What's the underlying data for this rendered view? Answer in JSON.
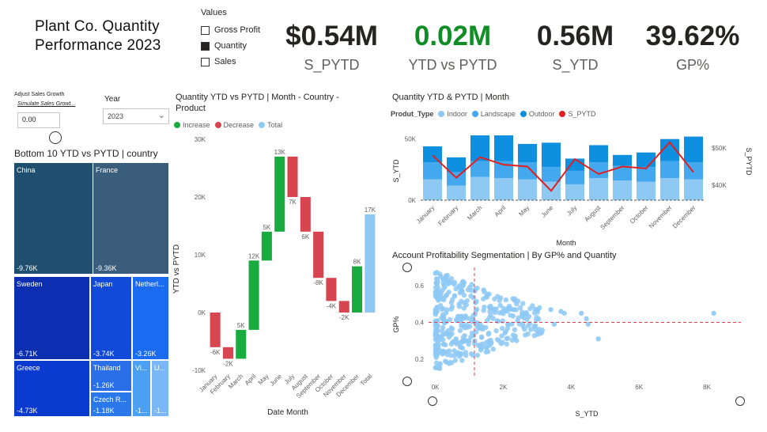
{
  "title": "Plant Co. Quantity Performance 2023",
  "title_line1": "Plant Co. Quantity",
  "title_line2": "Performance 2023",
  "values_legend": {
    "header": "Values",
    "options": [
      {
        "label": "Gross Profit",
        "selected": false
      },
      {
        "label": "Quantity",
        "selected": true
      },
      {
        "label": "Sales",
        "selected": false
      }
    ]
  },
  "kpis": [
    {
      "value": "$0.54M",
      "label": "S_PYTD"
    },
    {
      "value": "0.02M",
      "label": "YTD vs PYTD"
    },
    {
      "value": "0.56M",
      "label": "S_YTD"
    },
    {
      "value": "39.62%",
      "label": "GP%"
    }
  ],
  "growth": {
    "label": "Adjust Sales Growth",
    "sub": "Simulate Sales Growt...",
    "value": "0.00"
  },
  "year_filter": {
    "label": "Year",
    "value": "2023"
  },
  "treemap": {
    "title": "Bottom 10 YTD vs PYTD | country",
    "tiles": [
      {
        "name": "China",
        "value": "-9.76K",
        "color": "#1f4e6e"
      },
      {
        "name": "France",
        "value": "-9.36K",
        "color": "#3b5d7c"
      },
      {
        "name": "Sweden",
        "value": "-6.71K",
        "color": "#0b2fb0"
      },
      {
        "name": "Japan",
        "value": "-3.74K",
        "color": "#1149d8"
      },
      {
        "name": "Netherl...",
        "value": "-3.26K",
        "color": "#1a6bf0"
      },
      {
        "name": "Greece",
        "value": "-4.73K",
        "color": "#0b3ad0"
      },
      {
        "name": "Thailand",
        "value": "-1.26K",
        "color": "#2a6fe8"
      },
      {
        "name": "Czech R...",
        "value": "-1.18K",
        "color": "#2a78ea"
      },
      {
        "name": "Vi...",
        "value": "-1...",
        "color": "#4ba0f2"
      },
      {
        "name": "U...",
        "value": "-1...",
        "color": "#7ab8f5"
      }
    ]
  },
  "waterfall": {
    "title_line1": "Quantity YTD vs PYTD | Month - Country -",
    "title_line2": "Product",
    "legend": [
      {
        "label": "Increase",
        "color": "#1aab40"
      },
      {
        "label": "Decrease",
        "color": "#d64550"
      },
      {
        "label": "Total",
        "color": "#8ec9f4"
      }
    ],
    "ylabel": "YTD vs PYTD",
    "xlabel": "Date Month"
  },
  "combo": {
    "title": "Quantity YTD & PYTD | Month",
    "legend_title": "Produt_Type",
    "legend": [
      {
        "label": "Indoor",
        "color": "#8ec9f4"
      },
      {
        "label": "Landscape",
        "color": "#44a8ee"
      },
      {
        "label": "Outdoor",
        "color": "#0f8fe0"
      },
      {
        "label": "S_PYTD",
        "color": "#e02020"
      }
    ],
    "ylabel": "S_YTD",
    "y2label": "S_PYTD",
    "xlabel": "Month"
  },
  "scatter": {
    "title": "Account Profitability Segmentation | By GP% and Quantity",
    "xlabel": "S_YTD",
    "ylabel": "GP%"
  },
  "chart_data": [
    {
      "type": "bar",
      "subtype": "waterfall",
      "title": "Quantity YTD vs PYTD | Month - Country - Product",
      "xlabel": "Date Month",
      "ylabel": "YTD vs PYTD",
      "ylim": [
        -10000,
        30000
      ],
      "yticks": [
        "-10K",
        "0K",
        "10K",
        "20K",
        "30K"
      ],
      "categories": [
        "January",
        "February",
        "March",
        "April",
        "May",
        "June",
        "July",
        "August",
        "September",
        "October",
        "November",
        "December",
        "Total"
      ],
      "values": [
        -6000,
        -2000,
        5000,
        12000,
        5000,
        13000,
        -7000,
        -6000,
        -8000,
        -4000,
        -2000,
        8000,
        17000
      ],
      "labels": [
        "-6K",
        "-2K",
        "5K",
        "12K",
        "5K",
        "13K",
        "7K",
        "6K",
        "-8K",
        "-4K",
        "-2K",
        "8K",
        "17K"
      ],
      "kinds": [
        "decrease",
        "decrease",
        "increase",
        "increase",
        "increase",
        "increase",
        "decrease",
        "decrease",
        "decrease",
        "decrease",
        "decrease",
        "increase",
        "total"
      ]
    },
    {
      "type": "bar",
      "subtype": "stacked-column-line",
      "title": "Quantity YTD & PYTD | Month",
      "xlabel": "Month",
      "ylabel": "S_YTD",
      "y2label": "S_PYTD",
      "ylim": [
        0,
        55000
      ],
      "yticks": [
        "0K",
        "50K"
      ],
      "y2ticks": [
        "$40K",
        "$50K"
      ],
      "categories": [
        "January",
        "February",
        "March",
        "April",
        "May",
        "June",
        "July",
        "August",
        "September",
        "October",
        "November",
        "December"
      ],
      "series": [
        {
          "name": "Indoor",
          "values": [
            17000,
            12000,
            19000,
            18000,
            17000,
            15000,
            13000,
            18000,
            16000,
            15000,
            18000,
            17000
          ]
        },
        {
          "name": "Landscape",
          "values": [
            14000,
            11000,
            13000,
            14000,
            14000,
            12000,
            11000,
            13000,
            12000,
            12000,
            14000,
            14000
          ]
        },
        {
          "name": "Outdoor",
          "values": [
            13000,
            12000,
            21000,
            21000,
            15000,
            20000,
            10000,
            14000,
            9000,
            12000,
            18000,
            21000
          ]
        }
      ],
      "line": {
        "name": "S_PYTD",
        "values": [
          48000,
          42000,
          47500,
          45500,
          45000,
          38500,
          47000,
          43000,
          45000,
          44500,
          51500,
          43500
        ],
        "ylim2": [
          36000,
          54000
        ]
      }
    },
    {
      "type": "scatter",
      "title": "Account Profitability Segmentation | By GP% and Quantity",
      "xlabel": "S_YTD",
      "ylabel": "GP%",
      "xticks": [
        "0K",
        "2K",
        "4K",
        "6K",
        "8K"
      ],
      "yticks": [
        "0.2",
        "0.4",
        "0.6"
      ],
      "xlim": [
        -200,
        9000
      ],
      "ylim": [
        0.13,
        0.7
      ],
      "reference_lines": {
        "x": 1150,
        "y": 0.4
      },
      "points": [
        [
          8200,
          0.45
        ],
        [
          4450,
          0.42
        ],
        [
          4300,
          0.45
        ],
        [
          4500,
          0.39
        ],
        [
          4800,
          0.31
        ],
        [
          3400,
          0.47
        ],
        [
          3800,
          0.45
        ],
        [
          3700,
          0.46
        ],
        [
          3500,
          0.39
        ]
      ]
    }
  ]
}
